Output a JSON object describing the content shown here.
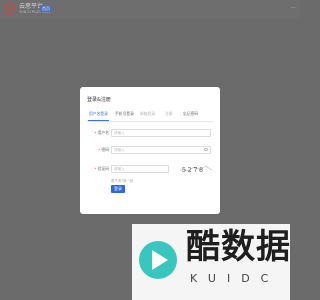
{
  "topbar": {
    "brand_title": "云思平台",
    "brand_subtitle": "YUN SI PLATFORM",
    "button_label": "首页",
    "right_text": "⋯"
  },
  "dialog": {
    "title": "登录&注册",
    "tabs": [
      {
        "label": "用户名登录",
        "state": "active"
      },
      {
        "label": "手机号登录",
        "state": "normal"
      },
      {
        "label": "邮箱登录",
        "state": "disabled"
      },
      {
        "label": "注册",
        "state": "disabled"
      },
      {
        "label": "忘记密码",
        "state": "normal"
      }
    ],
    "fields": {
      "username": {
        "label": "用户名",
        "placeholder": "请输入"
      },
      "password": {
        "label": "密码",
        "placeholder": "请输入"
      },
      "captcha": {
        "label": "验证码",
        "placeholder": "请输入",
        "captcha_text": "5 2 7 8"
      }
    },
    "help_text": "看不清?换一张",
    "login_button": "登录"
  },
  "watermark": {
    "title": "酷数据",
    "subtitle": "KUIDC"
  },
  "colors": {
    "overlay": "#6b6b6b",
    "accent": "#2f66d6",
    "required": "#e04b4b",
    "watermark_teal": "#38c6bf"
  }
}
